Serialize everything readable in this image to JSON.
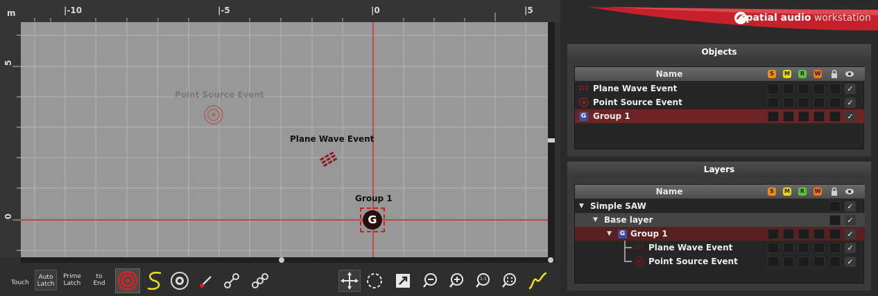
{
  "canvas": {
    "ruler_unit": "m",
    "top_ticks": [
      "|-10",
      "|-5",
      "|0",
      "|5"
    ],
    "left_ticks": [
      "5",
      "0"
    ],
    "point_source_label": "Point Source Event",
    "plane_wave_label": "Plane Wave Event",
    "group_label": "Group 1",
    "group_glyph": "G"
  },
  "toolbar": {
    "touch": "Touch",
    "auto_latch_1": "Auto",
    "auto_latch_2": "Latch",
    "prime_latch_1": "Prime",
    "prime_latch_2": "Latch",
    "to_end_1": "to",
    "to_end_2": "End",
    "zoom_fit_label": "1:1",
    "icons": [
      "target-icon",
      "curve-s-icon",
      "rotate-knob-icon",
      "pen-arrow-icon",
      "link-icon",
      "chain-link-icon",
      "move-icon",
      "rotate-icon",
      "scale-icon",
      "zoom-out-icon",
      "zoom-in-icon",
      "zoom-1-1-icon",
      "zoom-fit-icon",
      "automation-curve-icon"
    ]
  },
  "brand": {
    "bold": "spatial audio",
    "light": " workstation",
    "accent": "#c8202a"
  },
  "objects": {
    "title": "Objects",
    "name_header": "Name",
    "badges": [
      "S",
      "M",
      "R",
      "W"
    ],
    "rows": [
      {
        "label": "Plane Wave Event",
        "icon": "plane-wave-icon",
        "visible": "✓"
      },
      {
        "label": "Point Source Event",
        "icon": "point-source-icon",
        "visible": "✓"
      },
      {
        "label": "Group 1",
        "icon": "group-icon",
        "glyph": "G",
        "visible": "✓"
      }
    ]
  },
  "layers": {
    "title": "Layers",
    "name_header": "Name",
    "badges": [
      "S",
      "M",
      "R",
      "W"
    ],
    "rows": [
      {
        "label": "Simple SAW",
        "visible": "✓"
      },
      {
        "label": "Base layer",
        "visible": "✓"
      },
      {
        "label": "Group 1",
        "glyph": "G",
        "visible": "✓"
      },
      {
        "label": "Plane Wave Event",
        "visible": "✓"
      },
      {
        "label": "Point Source Event",
        "visible": "✓"
      }
    ]
  },
  "colors": {
    "solo": "#f08a1a",
    "mute": "#e8d81a",
    "record": "#5cc33a",
    "write": "#f0781a",
    "crosshair": "#d01818",
    "selection": "#6e2424"
  }
}
